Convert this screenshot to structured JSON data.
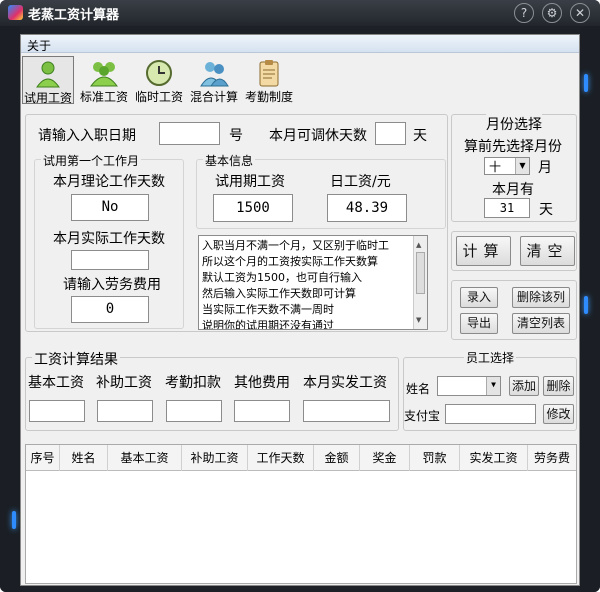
{
  "window": {
    "title": "老蒸工资计算器",
    "btn_help": "?",
    "btn_settings": "⚙",
    "btn_close": "✕"
  },
  "menu": {
    "about": "关于"
  },
  "toolbar": [
    {
      "label": "试用工资",
      "icon": "single-person-icon"
    },
    {
      "label": "标准工资",
      "icon": "group-people-icon"
    },
    {
      "label": "临时工资",
      "icon": "clock-icon"
    },
    {
      "label": "混合计算",
      "icon": "two-people-icon"
    },
    {
      "label": "考勤制度",
      "icon": "clipboard-icon"
    }
  ],
  "entry": {
    "date_prompt": "请输入入职日期",
    "date_value": "",
    "day_unit": "号",
    "rest_label": "本月可调休天数",
    "rest_value": "",
    "rest_unit": "天"
  },
  "first_month": {
    "title": "试用第一个工作月",
    "theory_label": "本月理论工作天数",
    "theory_value": "No",
    "actual_label": "本月实际工作天数",
    "actual_value": "",
    "labor_label": "请输入劳务费用",
    "labor_value": "0"
  },
  "basic_info": {
    "title": "基本信息",
    "trial_label": "试用期工资",
    "trial_value": "1500",
    "daily_label": "日工资/元",
    "daily_value": "48.39"
  },
  "notes": [
    "入职当月不满一个月，又区别于临时工",
    "所以这个月的工资按实际工作天数算",
    "默认工资为1500，也可自行输入",
    "然后输入实际工作天数即可计算",
    "当实际工作天数不满一周时",
    "说明你的试用期还没有通过"
  ],
  "month": {
    "title": "月份选择",
    "hint": "算前先选择月份",
    "selected": "十",
    "month_unit": "月",
    "days_label": "本月有",
    "days_value": "31",
    "days_unit": "天"
  },
  "actions": {
    "calc": "计算",
    "clear": "清空"
  },
  "list_actions": {
    "enter": "录入",
    "delete_row": "删除该列",
    "export": "导出",
    "clear_list": "清空列表"
  },
  "result": {
    "title": "工资计算结果",
    "labels": [
      "基本工资",
      "补助工资",
      "考勤扣款",
      "其他费用",
      "本月实发工资"
    ],
    "values": [
      "",
      "",
      "",
      "",
      ""
    ]
  },
  "employee": {
    "title": "员工选择",
    "name_label": "姓名",
    "name_value": "",
    "add": "添加",
    "delete": "删除",
    "alipay_label": "支付宝",
    "alipay_value": "",
    "modify": "修改"
  },
  "table": {
    "headers": [
      "序号",
      "姓名",
      "基本工资",
      "补助工资",
      "工作天数",
      "金额",
      "奖金",
      "罚款",
      "实发工资",
      "劳务费"
    ]
  }
}
